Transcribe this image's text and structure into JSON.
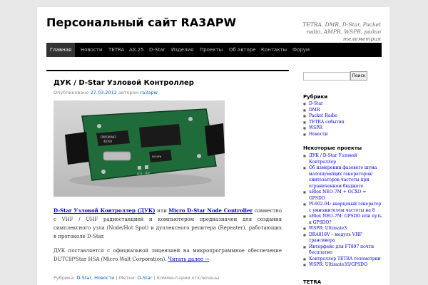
{
  "site": {
    "title": "Персональный сайт RA3APW",
    "description": "TETRA, DMR, D-Star, Packet radio, AMPR, WSPR, радио телеметрия"
  },
  "nav": [
    {
      "label": "Главная",
      "active": true
    },
    {
      "label": "Новости"
    },
    {
      "label": "TETRA"
    },
    {
      "label": "AX.25"
    },
    {
      "label": "D-Star"
    },
    {
      "label": "Изделия"
    },
    {
      "label": "Проекты"
    },
    {
      "label": "Об авторе"
    },
    {
      "label": "Контакты"
    },
    {
      "label": "Форум"
    }
  ],
  "post": {
    "title": "ДУК / D-Star Узловой Контроллер",
    "meta_prefix": "Опубликовано",
    "date": "27.03.2012",
    "meta_author_prefix": "автором",
    "author": "ra3apw",
    "link1": "D-Star Узловой Контроллер (ДУК)",
    "or": "или",
    "link2": "Micro D-Star Node Controller",
    "para1_rest": "совместно с VHF / UHF радиостанцией и компьютером предназначен для создания симплексного узла (Node/Hot Spot) и дуплексного репитера (Repeater), работающих в протоколе D-Star.",
    "para2": "ДУК поставляется с официальной лицензией на микропрограммное обеспечение DUTCH*Star HSA (Micro Walt Corporation).",
    "read_more": "Читать далее →",
    "footer_rubric": "Рубрика:",
    "footer_cat1": "D-Star",
    "footer_cat2": "Новости",
    "footer_tags": "| Метки:",
    "footer_tag": "D-Star",
    "footer_comments": "| Комментарии отключены"
  },
  "image_labels": {
    "chip1": "CMX589AD2",
    "chip2": "48704",
    "led1": "LD3",
    "led2": "LD2",
    "chip3": "RA3APW"
  },
  "sidebar": {
    "search_button": "Поиск",
    "rubrics_title": "Рубрики",
    "rubrics": [
      "D-Star",
      "DMR",
      "Packet Radio",
      "TETRA события",
      "WSPR",
      "Новости"
    ],
    "projects_title": "Некоторые проекты",
    "projects": [
      "ДУК / D-Star Узловой Контроллер",
      "Об измерении фазового шума малошумящих генераторов/синтезаторов частоты при ограниченном бюджете",
      "uBlox NEO-7M + OCXO = GPSDO",
      "PL602-04: кварцевый генератор с умножителем частоты на 8",
      "uBlox NEO-7M: GPSDO или путь к GPSDO?",
      "WSPR: Ultimate3",
      "DRA818V – модуль VHF трансивера",
      "Интерфейс для FT897 почти бесплатно",
      "Контроллер TETRA телеметрии",
      "WSPR: Ultimate3S/GPSDO"
    ],
    "tetra_title": "TETRA"
  },
  "colors": {
    "nav_bg": "#000000",
    "link": "#0000cc",
    "page_bg": "#e7e7e7"
  }
}
